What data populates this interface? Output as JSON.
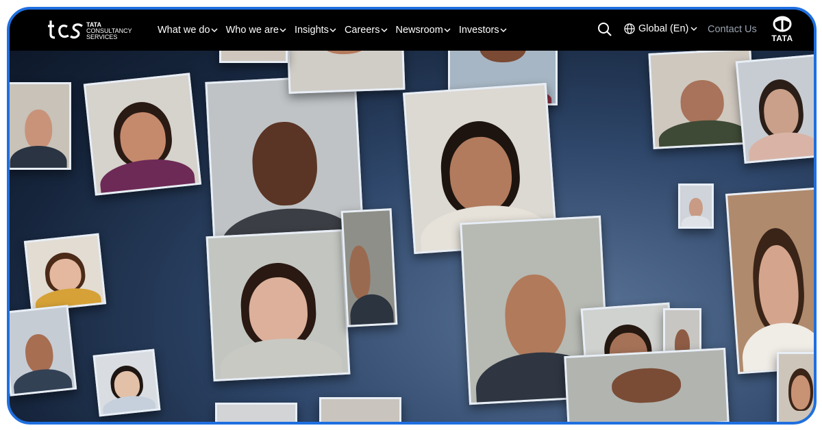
{
  "header": {
    "logo": {
      "mark": "tcs",
      "line1": "TATA",
      "line2": "CONSULTANCY",
      "line3": "SERVICES"
    },
    "nav": [
      {
        "label": "What we do"
      },
      {
        "label": "Who we are"
      },
      {
        "label": "Insights"
      },
      {
        "label": "Careers"
      },
      {
        "label": "Newsroom"
      },
      {
        "label": "Investors"
      }
    ],
    "region": "Global (En)",
    "contact": "Contact Us",
    "tata_word": "TATA"
  },
  "colors": {
    "frame_border": "#1f6fe0",
    "header_bg": "#000000",
    "contact_text": "#9aa3b0"
  },
  "icons": [
    "search-icon",
    "globe-icon",
    "chevron-down-icon",
    "tata-logo-icon",
    "tcs-logo-icon"
  ]
}
